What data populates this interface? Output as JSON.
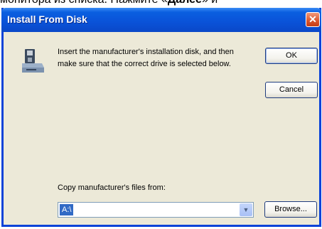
{
  "background_text": {
    "before": "монитора из списка. Нажмите «",
    "bold": "Далее",
    "after": "» и"
  },
  "dialog": {
    "title": "Install From Disk",
    "close_symbol": "✕",
    "message": "Insert the manufacturer's installation disk, and then make sure that the correct drive is selected below.",
    "ok_label": "OK",
    "cancel_label": "Cancel",
    "copy_label": "Copy manufacturer's files from:",
    "path_value": "A:\\",
    "browse_label": "Browse..."
  },
  "colors": {
    "titlebar": "#0a52d8",
    "dialog_bg": "#ece9d8",
    "selection": "#316ac5"
  },
  "icons": [
    "disk-drive-icon",
    "close-icon",
    "dropdown-arrow-icon"
  ]
}
